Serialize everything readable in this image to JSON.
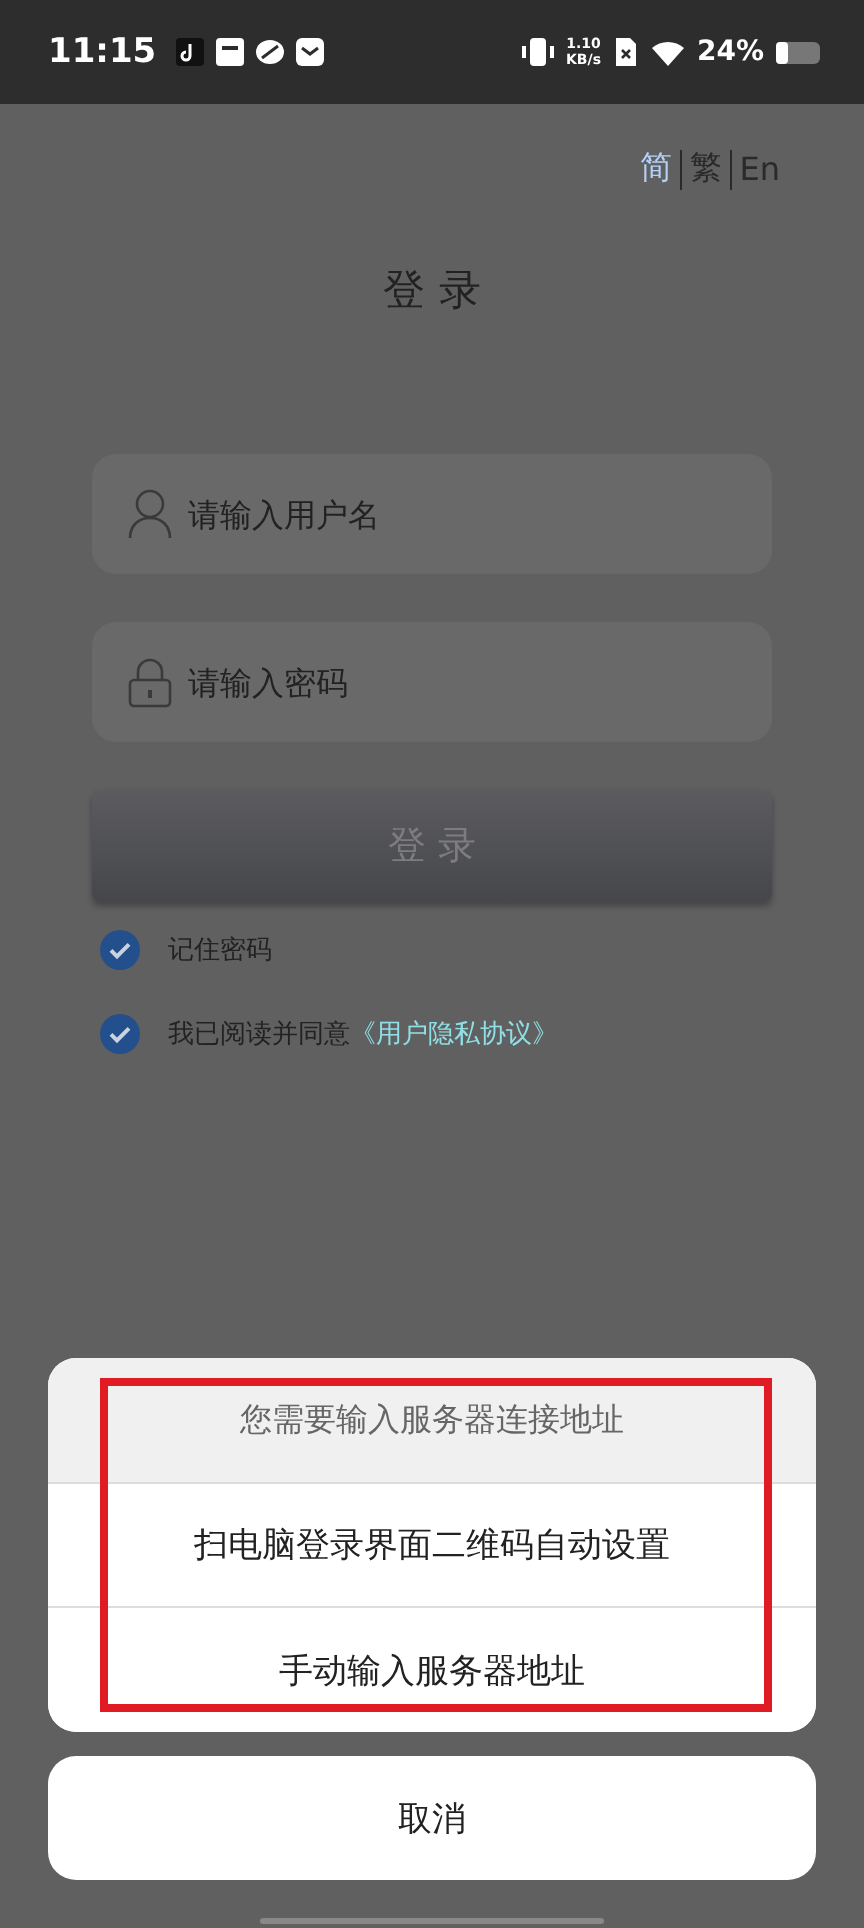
{
  "status_bar": {
    "time": "11:15",
    "net_speed": "1.10",
    "net_unit": "KB/s",
    "battery": "24%"
  },
  "languages": [
    {
      "label": "简",
      "selected": true
    },
    {
      "label": "繁",
      "selected": false
    },
    {
      "label": "En",
      "selected": false
    }
  ],
  "title": "登 录",
  "fields": [
    {
      "kind": "user",
      "placeholder": "请输入用户名"
    },
    {
      "kind": "password",
      "placeholder": "请输入密码"
    }
  ],
  "login_button": "登 录",
  "options": [
    {
      "label": "记住密码",
      "checked": true
    },
    {
      "label": "我已阅读并同意",
      "link": "《用户隐私协议》",
      "checked": true
    }
  ],
  "action_sheet": {
    "title": "您需要输入服务器连接地址",
    "items": [
      "扫电脑登录界面二维码自动设置",
      "手动输入服务器地址"
    ],
    "cancel": "取消",
    "highlighted": true
  }
}
